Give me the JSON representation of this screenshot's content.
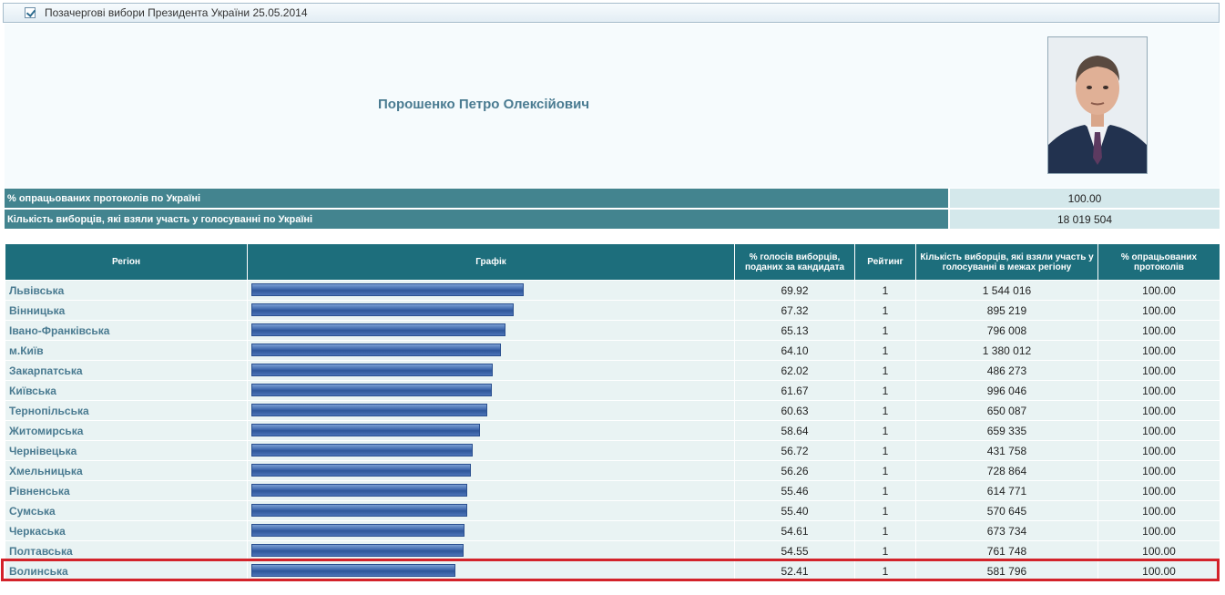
{
  "header": {
    "title": "Позачергові вибори Президента України 25.05.2014"
  },
  "candidate": {
    "name": "Порошенко Петро Олексійович"
  },
  "summary": [
    {
      "label": "% опрацьованих протоколів по Україні",
      "value": "100.00"
    },
    {
      "label": "Кількість виборців, які взяли участь у голосуванні по Україні",
      "value": "18 019 504"
    }
  ],
  "table": {
    "columns": {
      "region": "Регіон",
      "graph": "Графік",
      "percent": "% голосів виборців, поданих за кандидата",
      "rank": "Рейтинг",
      "voters": "Кількість виборців, які взяли участь у голосуванні в межах регіону",
      "processed": "% опрацьованих протоколів"
    },
    "rows": [
      {
        "region": "Львівська",
        "percent": "69.92",
        "rank": "1",
        "voters": "1 544 016",
        "processed": "100.00"
      },
      {
        "region": "Вінницька",
        "percent": "67.32",
        "rank": "1",
        "voters": "895 219",
        "processed": "100.00"
      },
      {
        "region": "Івано-Франківська",
        "percent": "65.13",
        "rank": "1",
        "voters": "796 008",
        "processed": "100.00"
      },
      {
        "region": "м.Київ",
        "percent": "64.10",
        "rank": "1",
        "voters": "1 380 012",
        "processed": "100.00"
      },
      {
        "region": "Закарпатська",
        "percent": "62.02",
        "rank": "1",
        "voters": "486 273",
        "processed": "100.00"
      },
      {
        "region": "Київська",
        "percent": "61.67",
        "rank": "1",
        "voters": "996 046",
        "processed": "100.00"
      },
      {
        "region": "Тернопільська",
        "percent": "60.63",
        "rank": "1",
        "voters": "650 087",
        "processed": "100.00"
      },
      {
        "region": "Житомирська",
        "percent": "58.64",
        "rank": "1",
        "voters": "659 335",
        "processed": "100.00"
      },
      {
        "region": "Чернівецька",
        "percent": "56.72",
        "rank": "1",
        "voters": "431 758",
        "processed": "100.00"
      },
      {
        "region": "Хмельницька",
        "percent": "56.26",
        "rank": "1",
        "voters": "728 864",
        "processed": "100.00"
      },
      {
        "region": "Рівненська",
        "percent": "55.46",
        "rank": "1",
        "voters": "614 771",
        "processed": "100.00"
      },
      {
        "region": "Сумська",
        "percent": "55.40",
        "rank": "1",
        "voters": "570 645",
        "processed": "100.00"
      },
      {
        "region": "Черкаська",
        "percent": "54.61",
        "rank": "1",
        "voters": "673 734",
        "processed": "100.00"
      },
      {
        "region": "Полтавська",
        "percent": "54.55",
        "rank": "1",
        "voters": "761 748",
        "processed": "100.00"
      },
      {
        "region": "Волинська",
        "percent": "52.41",
        "rank": "1",
        "voters": "581 796",
        "processed": "100.00"
      }
    ]
  },
  "colors": {
    "header_bg": "#1d6e7c",
    "label_bg": "#43848f",
    "bar": "#3d66ab",
    "highlight": "#d3232a"
  },
  "icons": {
    "checkbox": "checkbox-checked-icon"
  }
}
